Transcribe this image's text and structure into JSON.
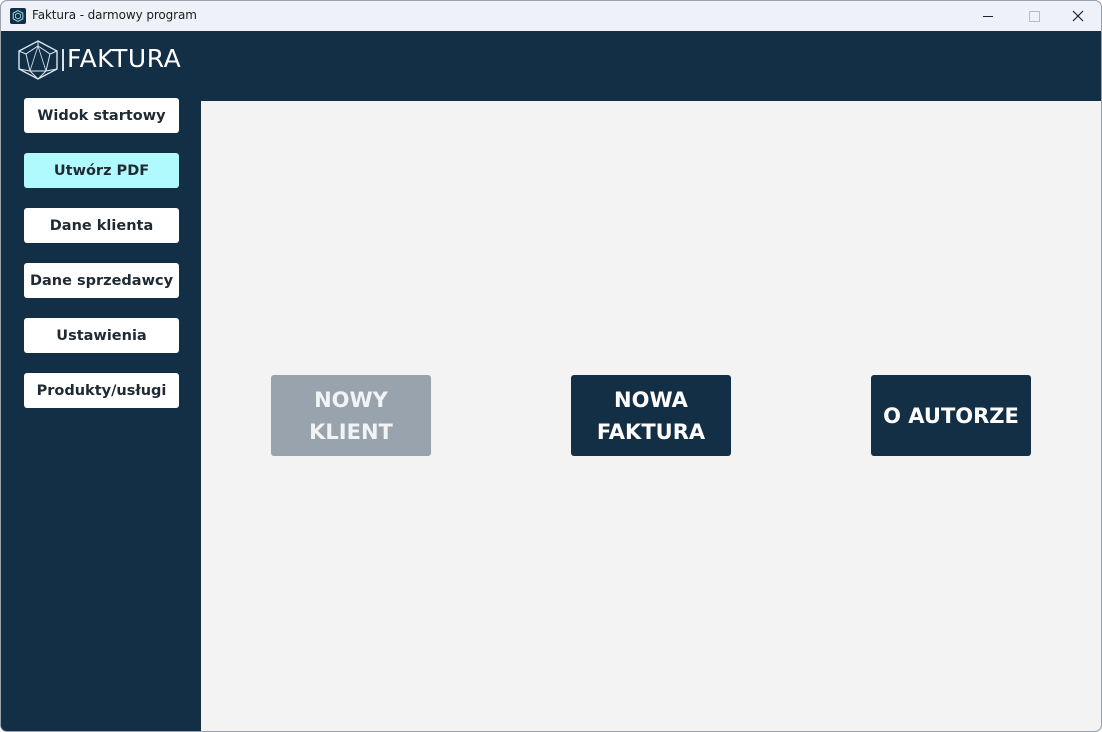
{
  "window": {
    "title": "Faktura - darmowy program"
  },
  "header": {
    "logo_text": "FAKTURA"
  },
  "sidebar": {
    "items": [
      {
        "label": "Widok startowy",
        "active": false
      },
      {
        "label": "Utwórz PDF",
        "active": true
      },
      {
        "label": "Dane klienta",
        "active": false
      },
      {
        "label": "Dane sprzedawcy",
        "active": false
      },
      {
        "label": "Ustawienia",
        "active": false
      },
      {
        "label": "Produkty/usługi",
        "active": false
      }
    ]
  },
  "main": {
    "new_client": {
      "line1": "NOWY",
      "line2": "KLIENT",
      "state": "disabled"
    },
    "new_invoice": {
      "line1": "NOWA",
      "line2": "FAKTURA",
      "state": "enabled"
    },
    "about_author": {
      "label": "O AUTORZE",
      "state": "enabled"
    }
  },
  "colors": {
    "primary_dark": "#132f46",
    "active_nav": "#b0fafd",
    "content_bg": "#f3f3f4",
    "disabled_button": "#98a3ad"
  },
  "icons": {
    "app": "hexagon-logo-icon",
    "minimize": "minimize-icon",
    "maximize": "maximize-icon",
    "close": "close-icon"
  }
}
